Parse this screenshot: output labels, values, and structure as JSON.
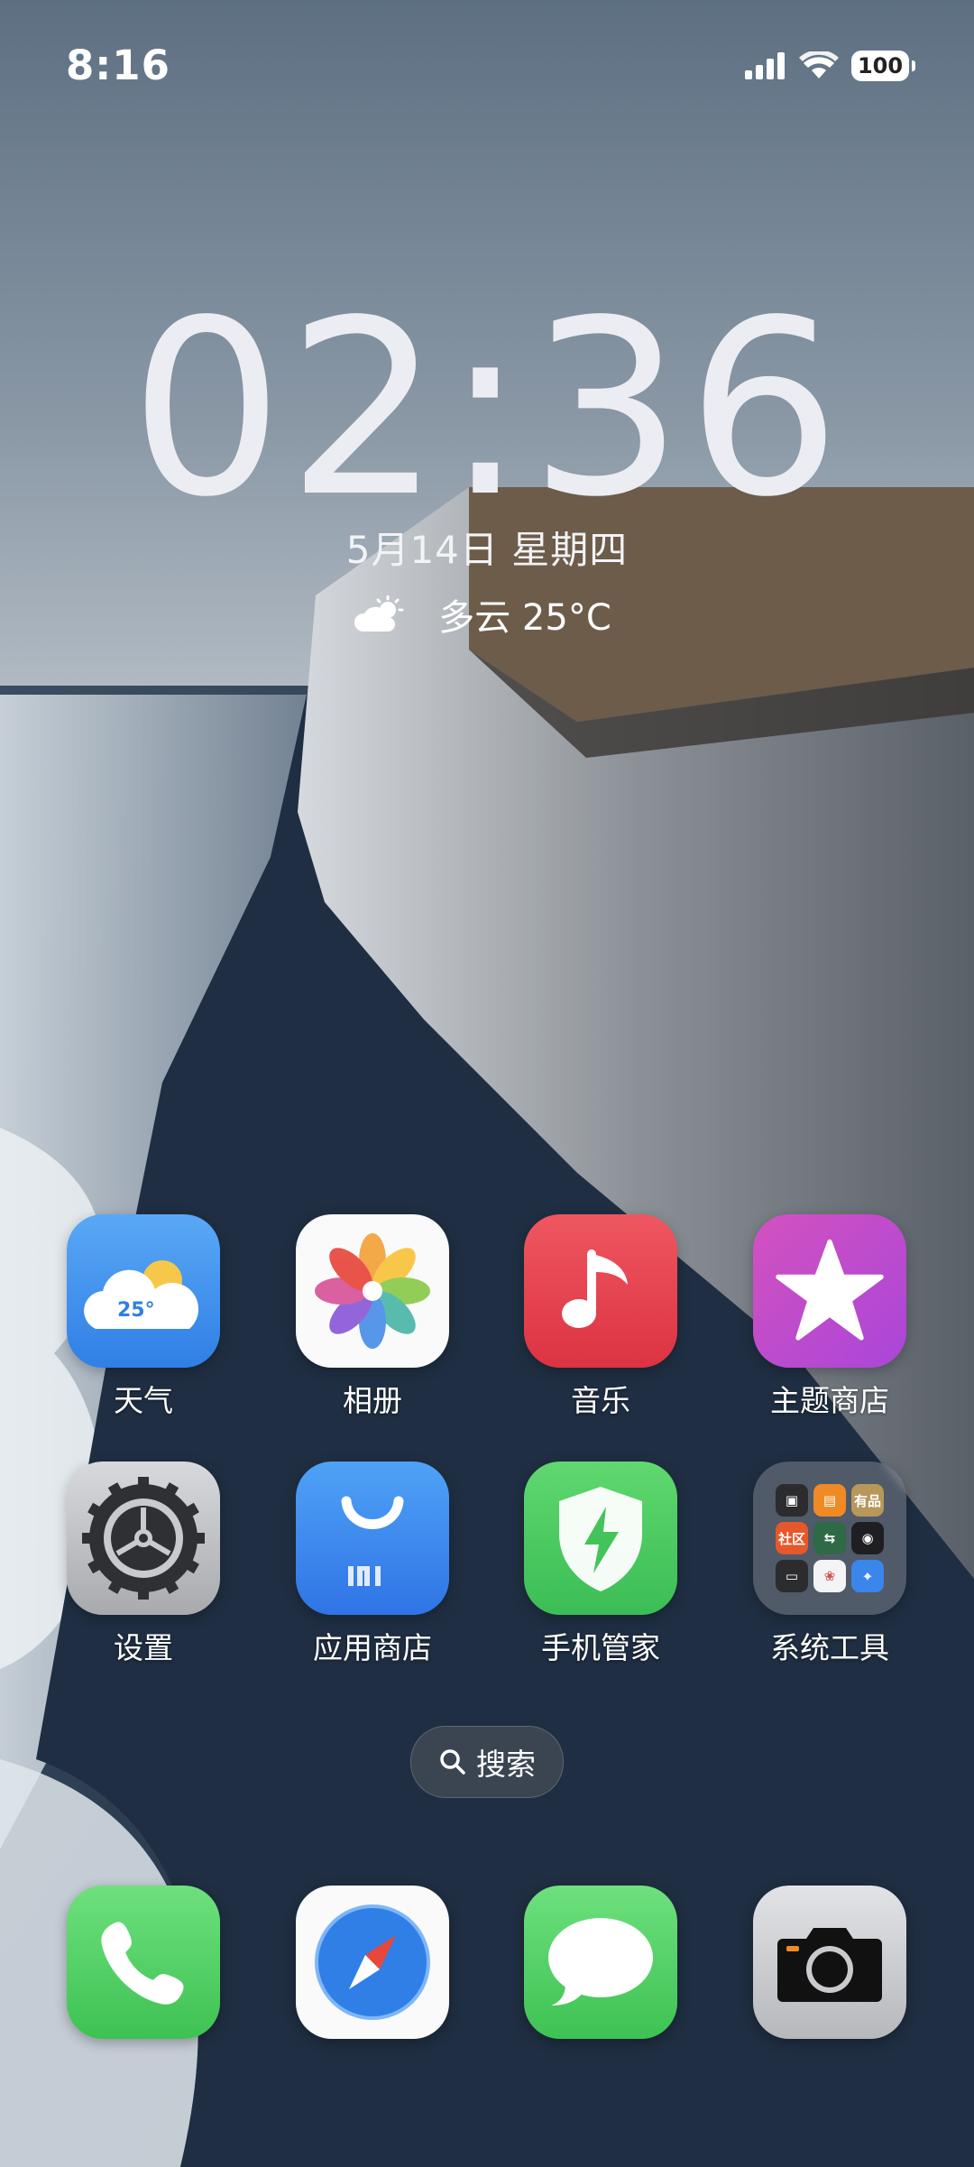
{
  "status_bar": {
    "time": "8:16",
    "battery": "100"
  },
  "lock_clock": {
    "time": "02:36",
    "date": "5月14日 星期四",
    "weather": "多云 25°C"
  },
  "apps_row1": [
    {
      "label": "天气",
      "badge": "25°",
      "icon": "weather-icon"
    },
    {
      "label": "相册",
      "icon": "photos-icon"
    },
    {
      "label": "音乐",
      "icon": "music-icon"
    },
    {
      "label": "主题商店",
      "icon": "theme-store-icon"
    }
  ],
  "apps_row2": [
    {
      "label": "设置",
      "icon": "settings-icon"
    },
    {
      "label": "应用商店",
      "icon": "app-store-icon"
    },
    {
      "label": "手机管家",
      "icon": "security-icon"
    },
    {
      "label": "系统工具",
      "icon": "folder-icon"
    }
  ],
  "folder_items": [
    "有品",
    "社区"
  ],
  "search": {
    "label": "搜索"
  },
  "dock": [
    {
      "icon": "phone-icon"
    },
    {
      "icon": "browser-icon"
    },
    {
      "icon": "messages-icon"
    },
    {
      "icon": "camera-icon"
    }
  ],
  "colors": {
    "weather_bg": "#3e8ff0",
    "music_bg": "#e6424e",
    "theme_bg": "#c449c6",
    "security_bg": "#4fcd63",
    "appstore_bg": "#3a88ee"
  }
}
